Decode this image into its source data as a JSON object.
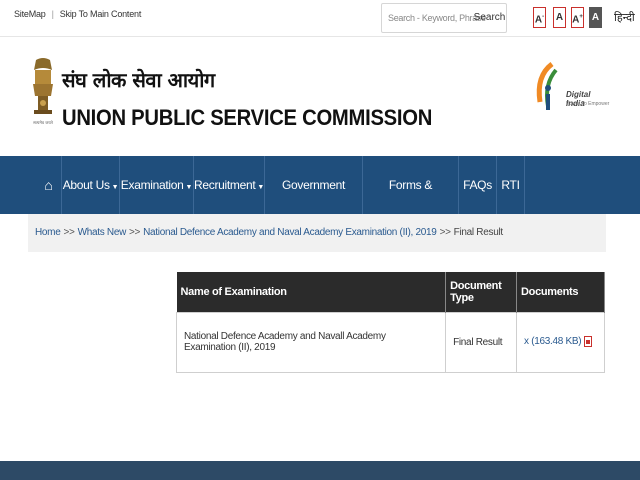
{
  "topbar": {
    "sitemap": "SiteMap",
    "skip": "Skip To Main Content",
    "search_placeholder": "Search - Keyword, Phrase",
    "search_button": "Search",
    "font_smaller": "A",
    "font_normal": "A",
    "font_larger": "A",
    "contrast": "A",
    "hindi": "हिन्दी"
  },
  "header": {
    "title_hindi": "संघ लोक सेवा आयोग",
    "title_english": "UNION PUBLIC SERVICE COMMISSION",
    "digital_india": "Digital India",
    "digital_tagline": "Power To Empower",
    "emblem_caption": "सत्यमेव जयते"
  },
  "nav": {
    "items": [
      {
        "label": "About Us",
        "dropdown": true
      },
      {
        "label": "Examination",
        "dropdown": true
      },
      {
        "label": "Recruitment",
        "dropdown": true
      },
      {
        "label": "Government Users",
        "dropdown": true
      },
      {
        "label": "Forms & Downloads",
        "dropdown": false
      },
      {
        "label": "FAQs",
        "dropdown": false
      },
      {
        "label": "RTI",
        "dropdown": false
      }
    ]
  },
  "breadcrumb": {
    "home": "Home",
    "whats_new": "Whats New",
    "exam": "National Defence Academy and Naval Academy Examination (II), 2019",
    "current": "Final Result",
    "sep": ">>"
  },
  "table": {
    "headers": [
      "Name of Examination",
      "Document Type",
      "Documents"
    ],
    "rows": [
      {
        "exam": "National Defence Academy and Navall Academy Examination (II), 2019",
        "type": "Final Result",
        "doc_prefix": "x",
        "doc_size": "(163.48 KB)"
      }
    ]
  },
  "colors": {
    "nav_bg": "#1f4e7c",
    "table_header_bg": "#2b2b2b",
    "link": "#2a5a8f"
  }
}
